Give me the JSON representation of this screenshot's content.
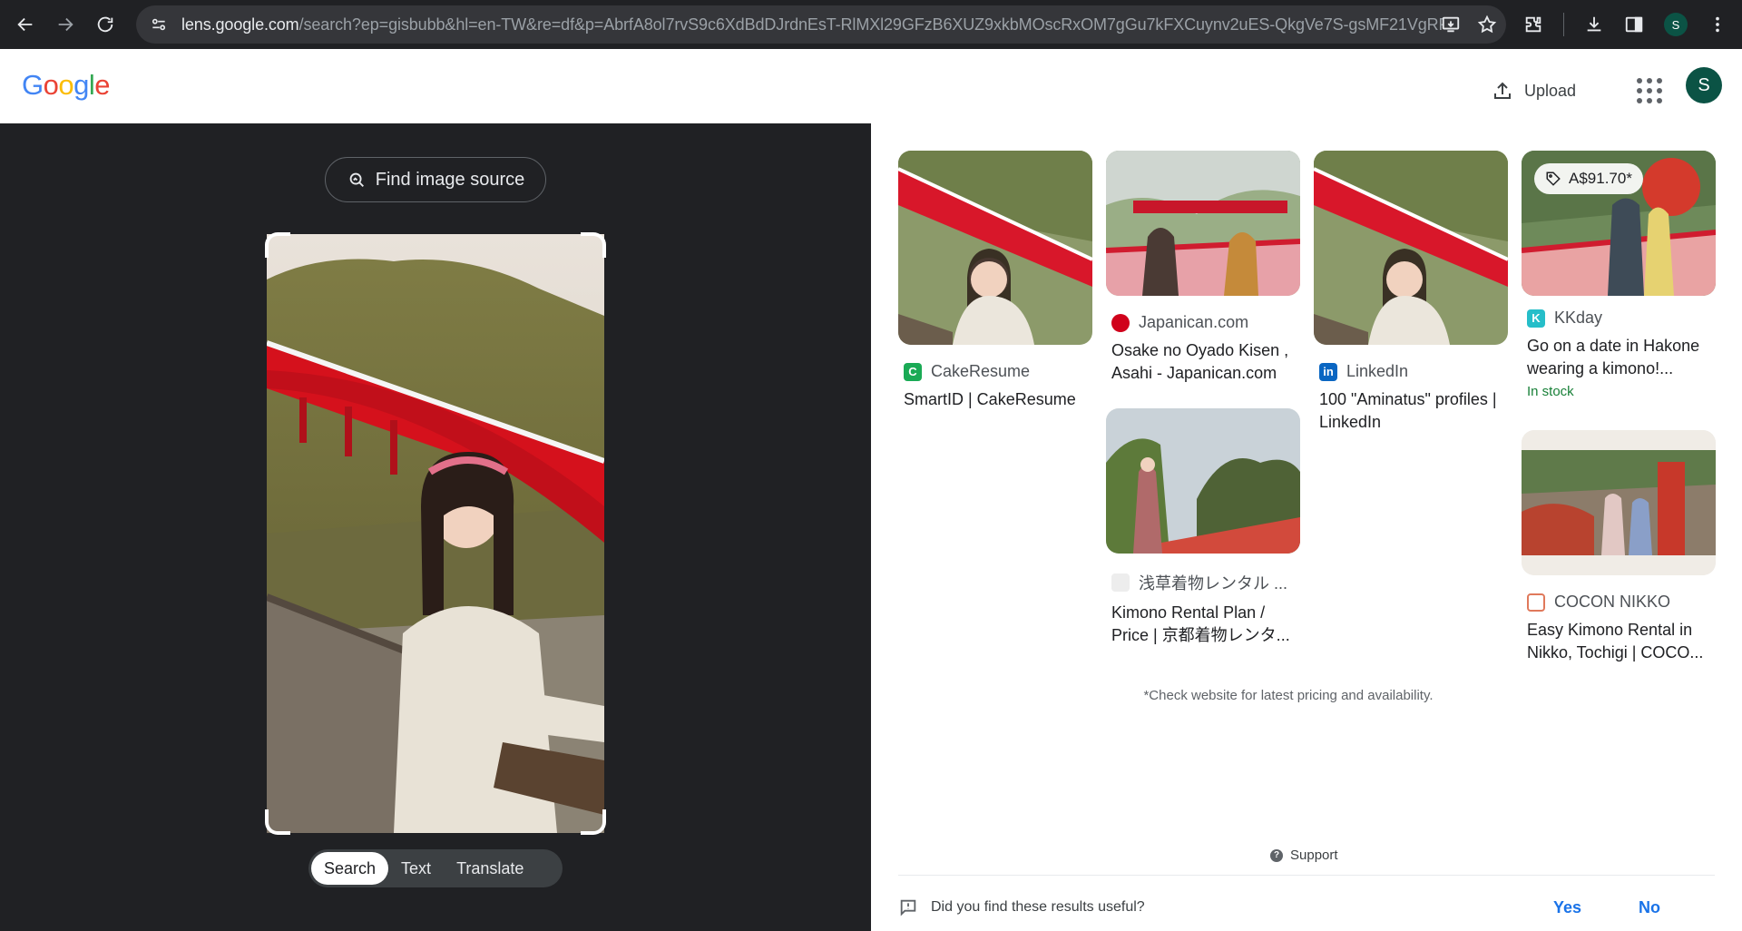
{
  "browser": {
    "url_host": "lens.google.com",
    "url_path": "/search?ep=gisbubb&hl=en-TW&re=df&p=AbrfA8ol7rvS9c6XdBdDJrdnEsT-RlMXl29GFzB6XUZ9xkbMOscRxOM7gGu7kFXCuynv2uES-QkgVe7S-gsMF21VgRFu4...",
    "profile_initial": "S"
  },
  "header": {
    "logo": "Google",
    "upload_label": "Upload",
    "avatar_initial": "S"
  },
  "left": {
    "find_source_label": "Find image source",
    "tabs": [
      {
        "label": "Search",
        "active": true
      },
      {
        "label": "Text",
        "active": false
      },
      {
        "label": "Translate",
        "active": false
      }
    ]
  },
  "results": [
    {
      "source": "CakeResume",
      "title": "SmartID | CakeResume",
      "favicon_color": "#1aaa55",
      "favicon_glyph": "C",
      "price": "",
      "stock": ""
    },
    {
      "source": "Japanican.com",
      "title": "Osake no Oyado Kisen , Asahi - Japanican.com",
      "favicon_color": "#d0021b",
      "favicon_glyph": "",
      "price": "",
      "stock": ""
    },
    {
      "source": "LinkedIn",
      "title": "100 \"Aminatus\" profiles | LinkedIn",
      "favicon_color": "#0a66c2",
      "favicon_glyph": "in",
      "price": "",
      "stock": ""
    },
    {
      "source": "KKday",
      "title": "Go on a date in Hakone wearing a kimono!...",
      "favicon_color": "#26bec9",
      "favicon_glyph": "K",
      "price": "A$91.70*",
      "stock": "In stock"
    },
    {
      "source": "浅草着物レンタル ...",
      "title": "Kimono Rental Plan / Price | 京都着物レンタ...",
      "favicon_color": "#cfcfcf",
      "favicon_glyph": "",
      "price": "",
      "stock": ""
    },
    {
      "source": "COCON NIKKO",
      "title": "Easy Kimono Rental in Nikko, Tochigi | COCO...",
      "favicon_color": "#e0795b",
      "favicon_glyph": "",
      "price": "",
      "stock": ""
    }
  ],
  "disclaimer": "*Check website for latest pricing and availability.",
  "support_label": "Support",
  "feedback": {
    "question": "Did you find these results useful?",
    "yes": "Yes",
    "no": "No"
  }
}
